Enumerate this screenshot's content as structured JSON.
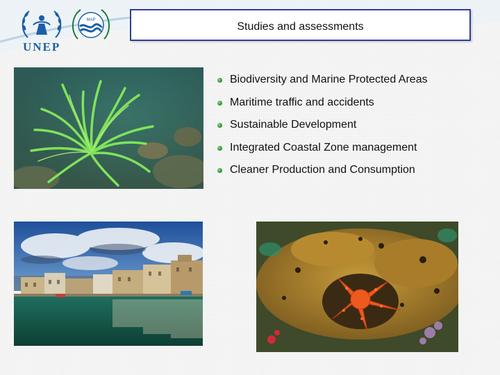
{
  "header": {
    "title": "Studies and assessments",
    "logo_text": "UNEP",
    "map_logo_text": "MAP"
  },
  "topics": [
    {
      "label": "Biodiversity and Marine Protected Areas"
    },
    {
      "label": "Maritime traffic and accidents"
    },
    {
      "label": "Sustainable Development"
    },
    {
      "label": "Integrated Coastal Zone management"
    },
    {
      "label": "Cleaner Production and Consumption"
    }
  ],
  "colors": {
    "title_border": "#2b3f9a",
    "bullet": "#1f8a2a",
    "unep_blue": "#1a5fa8"
  }
}
